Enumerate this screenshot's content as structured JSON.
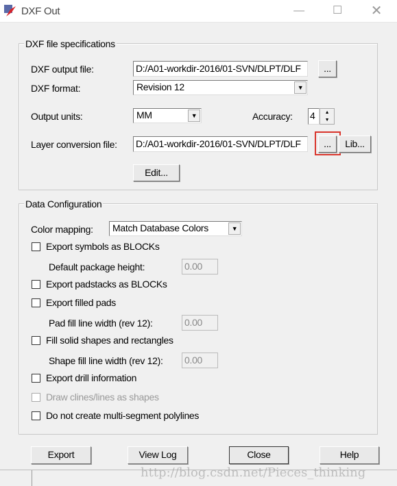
{
  "window": {
    "title": "DXF Out",
    "icon": "dxf-app-icon",
    "controls": [
      "minimize-icon",
      "maximize-icon",
      "close-icon"
    ]
  },
  "spec": {
    "legend": "DXF file specifications",
    "output_file_label": "DXF output file:",
    "output_file_value": "D:/A01-workdir-2016/01-SVN/DLPT/DLF",
    "browse_label": "...",
    "format_label": "DXF format:",
    "format_value": "Revision 12",
    "units_label": "Output units:",
    "units_value": "MM",
    "accuracy_label": "Accuracy:",
    "accuracy_value": "4",
    "layer_label": "Layer conversion file:",
    "layer_value": "D:/A01-workdir-2016/01-SVN/DLPT/DLF",
    "layer_browse_label": "...",
    "lib_label": "Lib...",
    "edit_label": "Edit...",
    "highlight_color": "#d9342b"
  },
  "config": {
    "legend": "Data Configuration",
    "color_mapping_label": "Color mapping:",
    "color_mapping_value": "Match Database Colors",
    "export_symbols": "Export symbols as BLOCKs",
    "pkg_height_label": "Default package height:",
    "pkg_height_value": "0.00",
    "export_padstacks": "Export padstacks as BLOCKs",
    "export_filled_pads": "Export filled pads",
    "pad_fill_label": "Pad fill line width (rev 12):",
    "pad_fill_value": "0.00",
    "fill_shapes": "Fill solid shapes and rectangles",
    "shape_fill_label": "Shape fill line width (rev 12):",
    "shape_fill_value": "0.00",
    "export_drill": "Export drill information",
    "draw_clines": "Draw clines/lines as shapes",
    "no_multiseg": "Do not create multi-segment polylines"
  },
  "buttons": {
    "export": "Export",
    "view_log": "View Log",
    "close": "Close",
    "help": "Help"
  },
  "watermark": "http://blog.csdn.net/Pieces_thinking"
}
